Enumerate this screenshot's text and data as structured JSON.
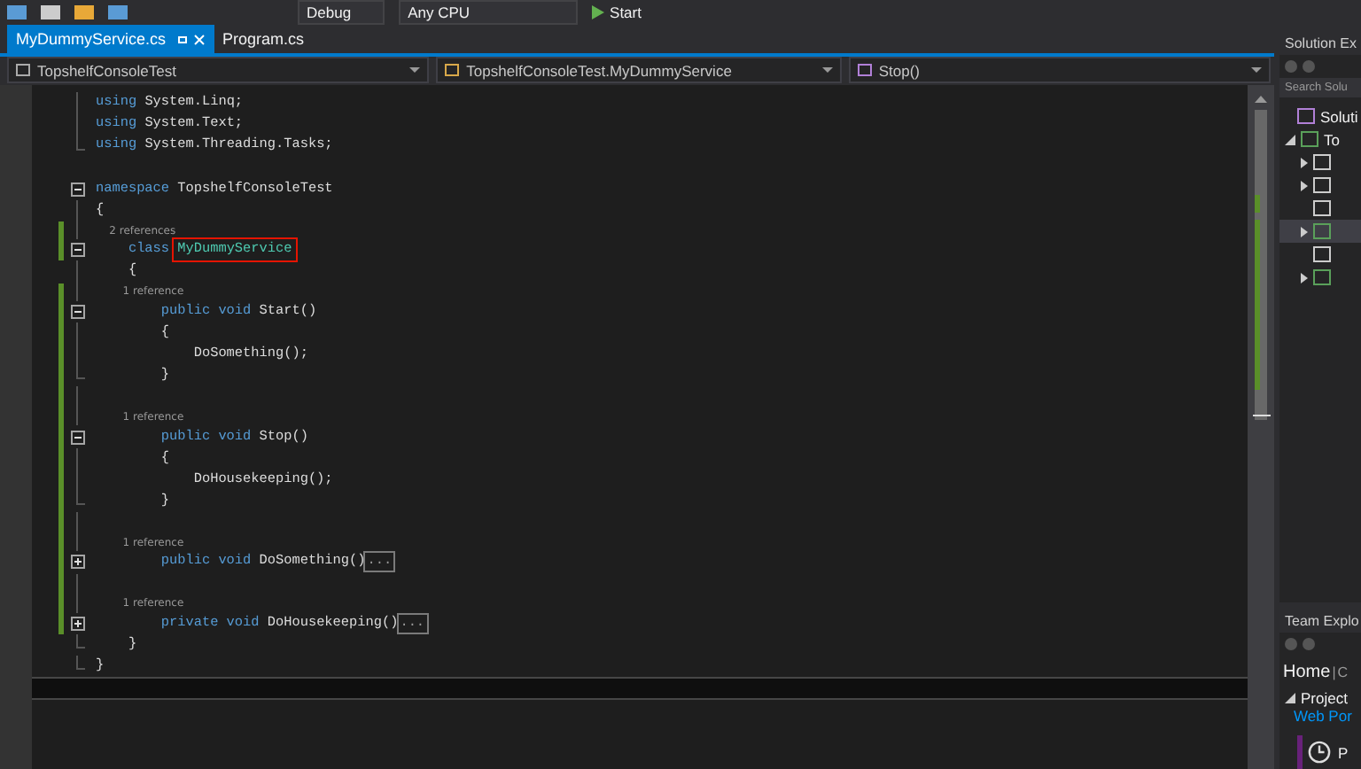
{
  "toolbar": {
    "configuration": "Debug",
    "platform": "Any CPU",
    "start": "Start"
  },
  "tabs": [
    {
      "label": "MyDummyService.cs",
      "selected": true
    },
    {
      "label": "Program.cs",
      "selected": false
    }
  ],
  "navbar": [
    "TopshelfConsoleTest",
    "TopshelfConsoleTest.MyDummyService",
    "Stop()"
  ],
  "code": [
    {
      "kind": "code",
      "margin": {
        "kind": "bar"
      },
      "changed": false,
      "tokens": [
        {
          "kind": "kw",
          "text": "using "
        },
        {
          "kind": "plain",
          "text": "System.Linq;"
        }
      ]
    },
    {
      "kind": "code",
      "margin": {
        "kind": "bar"
      },
      "changed": false,
      "tokens": [
        {
          "kind": "kw",
          "text": "using "
        },
        {
          "kind": "plain",
          "text": "System.Text;"
        }
      ]
    },
    {
      "kind": "code",
      "margin": {
        "kind": "end"
      },
      "changed": false,
      "tokens": [
        {
          "kind": "kw",
          "text": "using "
        },
        {
          "kind": "plain",
          "text": "System.Threading.Tasks;"
        }
      ]
    },
    {
      "kind": "blank",
      "changed": false
    },
    {
      "kind": "code",
      "margin": {
        "kind": "toggle",
        "collapsed": false
      },
      "changed": false,
      "tokens": [
        {
          "kind": "kw",
          "text": "namespace "
        },
        {
          "kind": "plain",
          "text": "TopshelfConsoleTest"
        }
      ]
    },
    {
      "kind": "code",
      "margin": {
        "kind": "bar"
      },
      "changed": false,
      "tokens": [
        {
          "kind": "plain",
          "text": "{"
        }
      ]
    },
    {
      "kind": "lens",
      "margin": {
        "kind": "bar"
      },
      "changed": true,
      "text": "    2 references"
    },
    {
      "kind": "code",
      "margin": {
        "kind": "toggle",
        "collapsed": false
      },
      "changed": true,
      "tokens": [
        {
          "kind": "kw",
          "text": "    class "
        },
        {
          "kind": "highlight",
          "text": "MyDummyService"
        }
      ]
    },
    {
      "kind": "code",
      "margin": {
        "kind": "bar"
      },
      "changed": false,
      "tokens": [
        {
          "kind": "plain",
          "text": "    {"
        }
      ]
    },
    {
      "kind": "lens",
      "margin": {
        "kind": "bar"
      },
      "changed": true,
      "text": "        1 reference"
    },
    {
      "kind": "code",
      "margin": {
        "kind": "toggle",
        "collapsed": false
      },
      "changed": true,
      "tokens": [
        {
          "kind": "kw",
          "text": "        public void "
        },
        {
          "kind": "plain",
          "text": "Start()"
        }
      ]
    },
    {
      "kind": "code",
      "margin": {
        "kind": "bar"
      },
      "changed": true,
      "tokens": [
        {
          "kind": "plain",
          "text": "        {"
        }
      ]
    },
    {
      "kind": "code",
      "margin": {
        "kind": "bar"
      },
      "changed": true,
      "tokens": [
        {
          "kind": "plain",
          "text": "            DoSomething();"
        }
      ]
    },
    {
      "kind": "code",
      "margin": {
        "kind": "end"
      },
      "changed": true,
      "tokens": [
        {
          "kind": "plain",
          "text": "        }"
        }
      ]
    },
    {
      "kind": "blank",
      "margin": {
        "kind": "bar"
      },
      "changed": true
    },
    {
      "kind": "lens",
      "margin": {
        "kind": "bar"
      },
      "changed": true,
      "text": "        1 reference"
    },
    {
      "kind": "code",
      "margin": {
        "kind": "toggle",
        "collapsed": false
      },
      "changed": true,
      "tokens": [
        {
          "kind": "kw",
          "text": "        public void "
        },
        {
          "kind": "plain",
          "text": "Stop()"
        }
      ]
    },
    {
      "kind": "code",
      "margin": {
        "kind": "bar"
      },
      "changed": true,
      "tokens": [
        {
          "kind": "plain",
          "text": "        {"
        }
      ]
    },
    {
      "kind": "code",
      "margin": {
        "kind": "bar"
      },
      "changed": true,
      "tokens": [
        {
          "kind": "plain",
          "text": "            DoHousekeeping();"
        }
      ]
    },
    {
      "kind": "code",
      "margin": {
        "kind": "end"
      },
      "changed": true,
      "tokens": [
        {
          "kind": "plain",
          "text": "        }"
        }
      ]
    },
    {
      "kind": "blank",
      "margin": {
        "kind": "bar"
      },
      "changed": true
    },
    {
      "kind": "lens",
      "margin": {
        "kind": "bar"
      },
      "changed": true,
      "text": "        1 reference"
    },
    {
      "kind": "code",
      "margin": {
        "kind": "toggle",
        "collapsed": true
      },
      "changed": true,
      "tokens": [
        {
          "kind": "kw",
          "text": "        public void "
        },
        {
          "kind": "plain",
          "text": "DoSomething()"
        },
        {
          "kind": "collapsed",
          "text": "..."
        }
      ]
    },
    {
      "kind": "blank",
      "margin": {
        "kind": "bar"
      },
      "changed": true
    },
    {
      "kind": "lens",
      "margin": {
        "kind": "bar"
      },
      "changed": true,
      "text": "        1 reference"
    },
    {
      "kind": "code",
      "margin": {
        "kind": "toggle",
        "collapsed": true
      },
      "changed": true,
      "tokens": [
        {
          "kind": "kw",
          "text": "        private void "
        },
        {
          "kind": "plain",
          "text": "DoHousekeeping()"
        },
        {
          "kind": "collapsed",
          "text": "..."
        }
      ]
    },
    {
      "kind": "code",
      "margin": {
        "kind": "end"
      },
      "changed": false,
      "tokens": [
        {
          "kind": "plain",
          "text": "    }"
        }
      ]
    },
    {
      "kind": "code",
      "margin": {
        "kind": "end"
      },
      "changed": false,
      "tokens": [
        {
          "kind": "plain",
          "text": "}"
        }
      ]
    },
    {
      "kind": "caret",
      "changed": false
    }
  ],
  "solution_explorer": {
    "title": "Solution Ex",
    "search": {
      "placeholder": "Search Solu"
    },
    "items": [
      {
        "label": "Soluti",
        "kind": "solution",
        "selected": false
      },
      {
        "label": "To",
        "kind": "project",
        "selected": false,
        "expanded": true,
        "children": [
          {
            "kind": "properties",
            "expandable": true,
            "selected": false
          },
          {
            "kind": "references",
            "expandable": true,
            "selected": false
          },
          {
            "kind": "config",
            "expandable": false,
            "selected": false
          },
          {
            "kind": "csharp",
            "expandable": true,
            "selected": true
          },
          {
            "kind": "config",
            "expandable": false,
            "selected": false
          },
          {
            "kind": "csharp",
            "expandable": true,
            "selected": false
          }
        ]
      }
    ]
  },
  "team_explorer": {
    "title": "Team Explo",
    "page": "Home",
    "separator": "|",
    "page_suffix": "C",
    "section": "Project",
    "link": "Web Por",
    "item": "P"
  }
}
